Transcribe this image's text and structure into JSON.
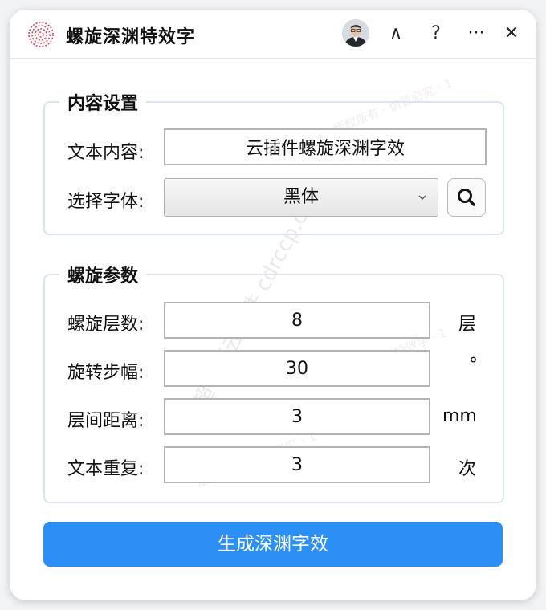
{
  "app": {
    "title": "螺旋深渊特效字"
  },
  "titlebar": {
    "collapse": "∧",
    "help": "?",
    "more": "···",
    "close": "✕"
  },
  "content_group": {
    "title": "内容设置",
    "text_label": "文本内容:",
    "text_value": "云插件螺旋深渊字效",
    "font_label": "选择字体:",
    "font_value": "黑体"
  },
  "spiral_group": {
    "title": "螺旋参数",
    "rows": [
      {
        "label": "螺旋层数:",
        "value": "8",
        "unit": "层"
      },
      {
        "label": "旋转步幅:",
        "value": "30",
        "unit": "°"
      },
      {
        "label": "层间距离:",
        "value": "3",
        "unit": "mm"
      },
      {
        "label": "文本重复:",
        "value": "3",
        "unit": "次"
      }
    ]
  },
  "generate_button": "生成深渊字效",
  "watermarks": {
    "brand": "超平面云插件 cdrccp.cn",
    "ver": "Zebe · 1",
    "rights": "版权所有 · 仿冒必究 · 1",
    "name": "螺旋深渊特效字 · 1"
  },
  "colors": {
    "accent": "#2b8ff5",
    "logo": "#e0455a"
  }
}
